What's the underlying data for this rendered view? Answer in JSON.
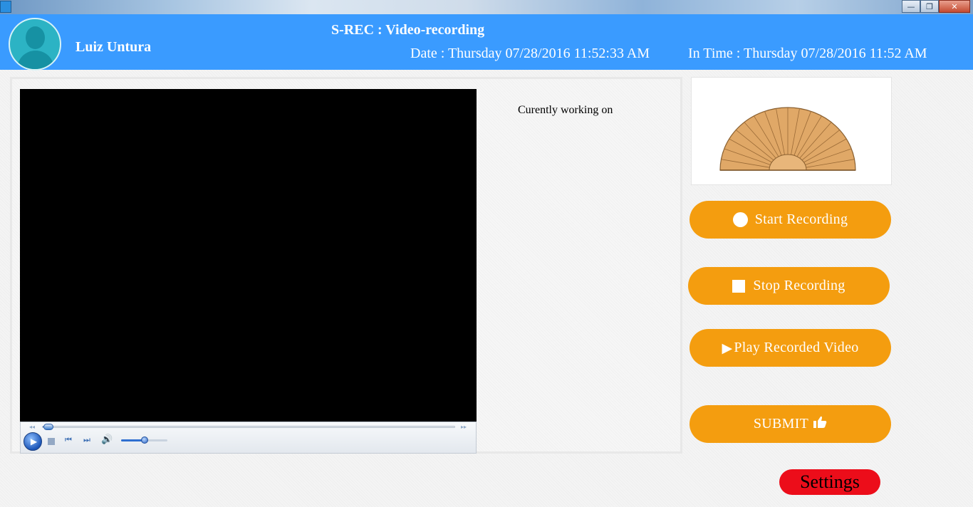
{
  "window": {
    "minimize_glyph": "—",
    "restore_glyph": "❐",
    "close_glyph": "✕"
  },
  "header": {
    "user_name": "Luiz Untura",
    "app_title": "S-REC : Video-recording",
    "date_text": "Date : Thursday 07/28/2016 11:52:33 AM",
    "in_time_text": "In Time : Thursday 07/28/2016 11:52 AM",
    "avatar_icon": "user-silhouette-icon",
    "background_color": "#3a9bff"
  },
  "player": {
    "seek_progress": 0.02,
    "volume_level": 0.5,
    "play_glyph": "▶",
    "prev_glyph": "⏮",
    "next_glyph": "⏭",
    "volume_glyph": "🔊",
    "seek_back_glyph": "◂◂",
    "seek_fwd_glyph": "▸▸"
  },
  "main": {
    "working_label": "Curently working on"
  },
  "actions": {
    "start_label": "Start Recording",
    "stop_label": "Stop Recording",
    "play_glyph": "▶",
    "play_label": "Play Recorded Video",
    "submit_label": "SUBMIT",
    "settings_label": "Settings",
    "button_color": "#f49d0f",
    "settings_color": "#ec0d1a"
  }
}
